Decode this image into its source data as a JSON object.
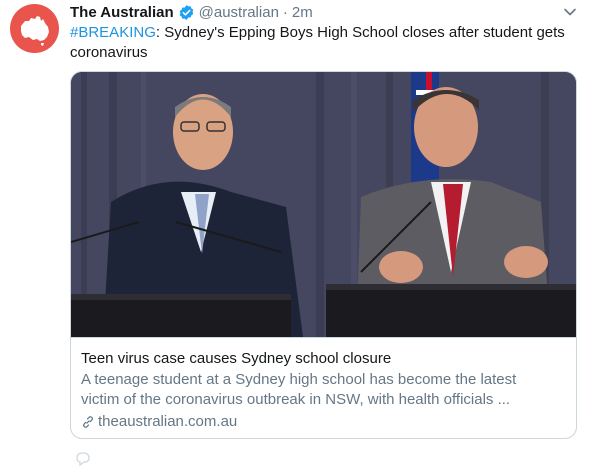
{
  "tweet": {
    "avatar_icon": "the-australian-map-logo",
    "author_name": "The Australian",
    "verified_icon": "verified-badge-icon",
    "handle": "@australian",
    "separator": "·",
    "time": "2m",
    "hashtag": "#BREAKING",
    "text_rest": ": Sydney's Epping Boys High School closes after student gets coronavirus",
    "menu_icon": "chevron-down-icon"
  },
  "card": {
    "image_alt": "Two men speaking at podiums with microphones at a press conference",
    "title": "Teen virus case causes Sydney school closure",
    "description_line1": "A teenage student at a Sydney high school has become the latest",
    "description_line2": "victim of the coronavirus outbreak in NSW, with health officials ...",
    "domain": "theaustralian.com.au",
    "link_icon": "link-icon"
  },
  "colors": {
    "accent": "#1b95e0",
    "avatar_bg": "#e9554d",
    "muted_text": "#657786",
    "border": "#ccd6dd"
  }
}
